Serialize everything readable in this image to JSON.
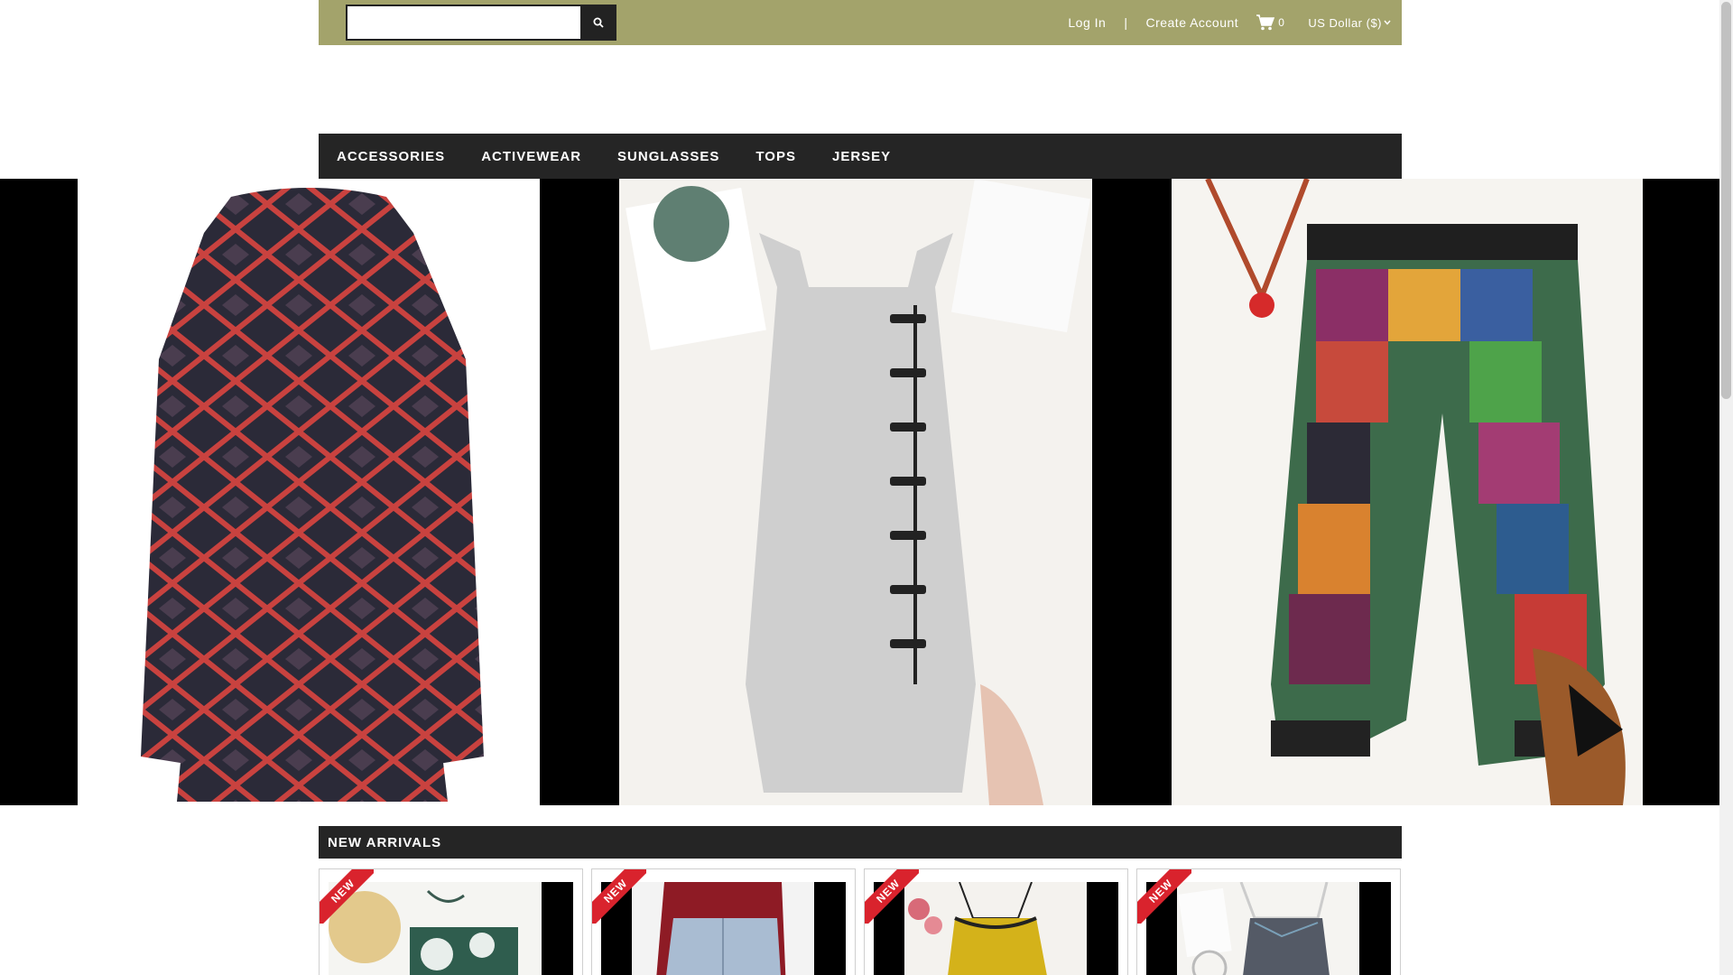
{
  "header": {
    "search": {
      "placeholder": ""
    },
    "login_label": "Log In",
    "separator": "|",
    "create_account_label": "Create Account",
    "cart_count": "0",
    "currency": "US Dollar ($)"
  },
  "nav": {
    "items": [
      {
        "label": "ACCESSORIES"
      },
      {
        "label": "ACTIVEWEAR"
      },
      {
        "label": "SUNGLASSES"
      },
      {
        "label": "TOPS"
      },
      {
        "label": "JERSEY"
      }
    ]
  },
  "new_arrivals": {
    "title": "NEW ARRIVALS",
    "products": [
      {
        "badge": "NEW",
        "icon": "tie-dye-top-image"
      },
      {
        "badge": "NEW",
        "icon": "jeans-image"
      },
      {
        "badge": "NEW",
        "icon": "yellow-satin-cami-image"
      },
      {
        "badge": "NEW",
        "icon": "striped-cami-image"
      }
    ]
  },
  "colors": {
    "topbar": "#a3a36b",
    "navbar": "#252525",
    "badge": "#d9232d"
  }
}
